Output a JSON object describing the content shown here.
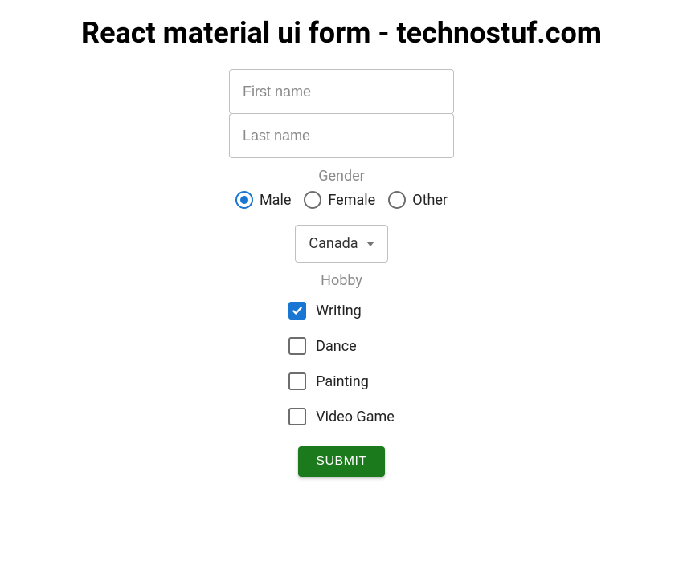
{
  "title": "React material ui form - technostuf.com",
  "fields": {
    "first_name": {
      "placeholder": "First name",
      "value": ""
    },
    "last_name": {
      "placeholder": "Last name",
      "value": ""
    }
  },
  "gender": {
    "label": "Gender",
    "options": [
      {
        "label": "Male",
        "selected": true
      },
      {
        "label": "Female",
        "selected": false
      },
      {
        "label": "Other",
        "selected": false
      }
    ]
  },
  "country": {
    "selected": "Canada"
  },
  "hobby": {
    "label": "Hobby",
    "options": [
      {
        "label": "Writing",
        "checked": true
      },
      {
        "label": "Dance",
        "checked": false
      },
      {
        "label": "Painting",
        "checked": false
      },
      {
        "label": "Video Game",
        "checked": false
      }
    ]
  },
  "submit_label": "SUBMIT"
}
